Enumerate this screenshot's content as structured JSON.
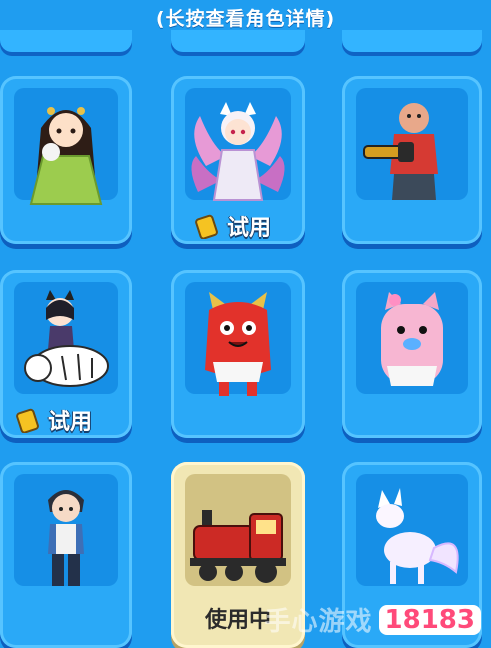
{
  "hint": "(长按查看角色详情)",
  "grid": {
    "row1": {
      "c1": "girl in green hanfu holding cotton candy",
      "c2": "white-haired nine-tailed fox girl",
      "c2_badge": "试用",
      "c3": "bald man with chainsaw"
    },
    "row2": {
      "c1": "cat-eared girl riding white tiger",
      "c1_badge": "试用",
      "c2": "red monster in diaper",
      "c3": "pink pig with pacifier"
    },
    "row3": {
      "c1": "boy in blue jacket",
      "c2": "red steam locomotive",
      "c2_status": "使用中",
      "c3": "white fox"
    }
  },
  "watermark": {
    "text": "手心游戏",
    "logo": "18183"
  },
  "colors": {
    "bg": "#1f9df0",
    "card": "#2aa9f7",
    "active_card": "#f1e7b4",
    "badge_text": "#ffffff"
  }
}
